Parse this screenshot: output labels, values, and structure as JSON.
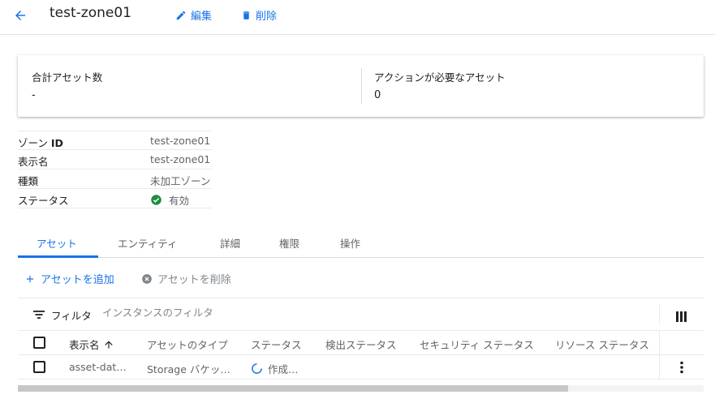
{
  "header": {
    "title": "test-zone01",
    "edit_label": "編集",
    "delete_label": "削除"
  },
  "summary": {
    "total_assets_label": "合計アセット数",
    "total_assets_value": "-",
    "action_needed_label": "アクションが必要なアセット",
    "action_needed_value": "0"
  },
  "details": {
    "zone_id_label": "ゾーン",
    "zone_id_label_bold": "ID",
    "zone_id_value": "test-zone01",
    "display_name_label": "表示名",
    "display_name_value": "test-zone01",
    "type_label": "種類",
    "type_value": "未加工ゾーン",
    "status_label": "ステータス",
    "status_value": "有効"
  },
  "tabs": [
    {
      "label": "アセット",
      "active": true
    },
    {
      "label": "エンティティ",
      "active": false
    },
    {
      "label": "詳細",
      "active": false
    },
    {
      "label": "権限",
      "active": false
    },
    {
      "label": "操作",
      "active": false
    }
  ],
  "asset_actions": {
    "add_label": "アセットを追加",
    "delete_label": "アセットを削除"
  },
  "filter": {
    "label": "フィルタ",
    "placeholder": "インスタンスのフィルタ"
  },
  "table": {
    "columns": [
      "表示名",
      "アセットのタイプ",
      "ステータス",
      "検出ステータス",
      "セキュリティ ステータス",
      "リソース ステータス"
    ],
    "rows": [
      {
        "display_name": "asset-dat…",
        "asset_type": "Storage バケッ…",
        "status": "作成…"
      }
    ]
  },
  "colors": {
    "accent": "#1a73e8",
    "success": "#1e8e3e"
  },
  "icons": {
    "back": "arrow-left-icon",
    "edit": "pencil-icon",
    "delete": "trash-icon",
    "add": "plus-icon",
    "remove": "cancel-circle-icon",
    "filter": "filter-lines-icon",
    "columns": "column-display-icon",
    "sort": "arrow-up-icon",
    "status_ok": "check-circle-icon",
    "loading": "spinner-icon",
    "more": "more-vert-icon"
  }
}
